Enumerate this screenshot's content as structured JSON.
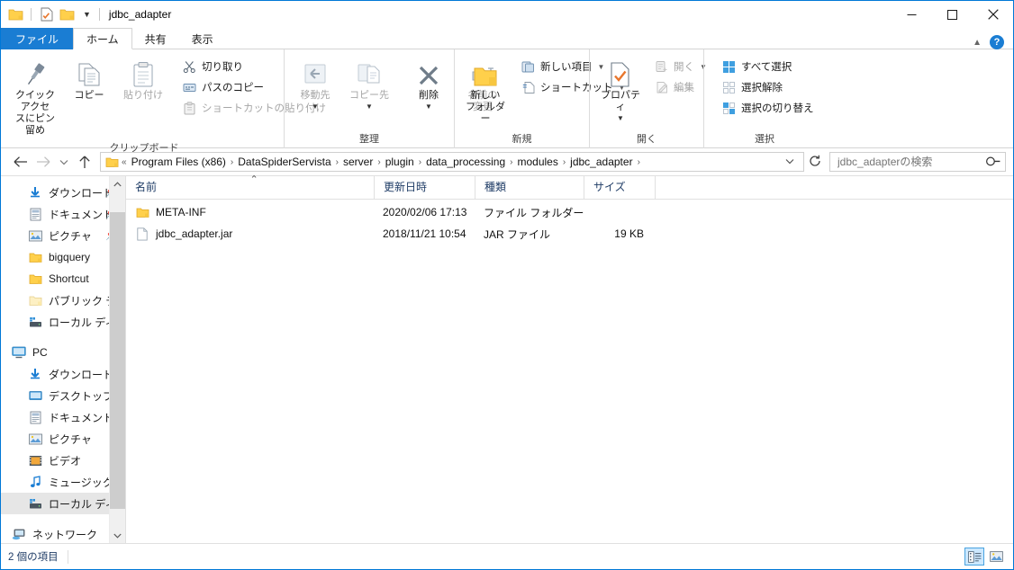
{
  "window": {
    "title": "jdbc_adapter",
    "quick_access": [
      {
        "name": "folder-icon",
        "label": "フォルダー"
      },
      {
        "name": "properties-icon",
        "label": "プロパティ"
      },
      {
        "name": "new-folder-icon",
        "label": "新しいフォルダー"
      }
    ],
    "controls": {
      "minimize": "—",
      "maximize": "☐",
      "close": "✕"
    }
  },
  "tabs": [
    {
      "label": "ファイル",
      "state": "file"
    },
    {
      "label": "ホーム",
      "state": "active"
    },
    {
      "label": "共有",
      "state": "normal"
    },
    {
      "label": "表示",
      "state": "normal"
    }
  ],
  "ribbon": {
    "help_label": "?",
    "groups": [
      {
        "label": "クリップボード",
        "big": [
          {
            "label": "クイック アクセ\nスにピン留め",
            "line1": "クイック アクセ",
            "line2": "スにピン留め",
            "icon": "pin-icon",
            "disabled": false
          },
          {
            "label": "コピー",
            "line1": "コピー",
            "line2": "",
            "icon": "copy-icon",
            "disabled": false
          },
          {
            "label": "貼り付け",
            "line1": "貼り付け",
            "line2": "",
            "icon": "paste-icon",
            "disabled": true
          }
        ],
        "small": [
          {
            "label": "切り取り",
            "icon": "scissors-icon",
            "disabled": false
          },
          {
            "label": "パスのコピー",
            "icon": "copy-path-icon",
            "disabled": false
          },
          {
            "label": "ショートカットの貼り付け",
            "icon": "paste-shortcut-icon",
            "disabled": true
          }
        ]
      },
      {
        "label": "整理",
        "big": [
          {
            "line1": "移動先",
            "line2": "",
            "icon": "move-to-icon",
            "disabled": true,
            "dropdown": true
          },
          {
            "line1": "コピー先",
            "line2": "",
            "icon": "copy-to-icon",
            "disabled": true,
            "dropdown": true
          },
          {
            "line1": "削除",
            "line2": "",
            "icon": "delete-icon",
            "disabled": false,
            "dropdown": true
          },
          {
            "line1": "名前の",
            "line2": "変更",
            "icon": "rename-icon",
            "disabled": true
          }
        ],
        "small": []
      },
      {
        "label": "新規",
        "big": [
          {
            "line1": "新しい",
            "line2": "フォルダー",
            "icon": "new-folder-icon",
            "disabled": false
          }
        ],
        "small": [
          {
            "label": "新しい項目",
            "icon": "new-item-icon",
            "disabled": false,
            "dropdown": true
          },
          {
            "label": "ショートカット",
            "icon": "shortcut-icon",
            "disabled": false,
            "dropdown": true
          }
        ]
      },
      {
        "label": "開く",
        "big": [
          {
            "line1": "プロパティ",
            "line2": "",
            "icon": "properties-icon",
            "disabled": false,
            "dropdown": true
          }
        ],
        "small": [
          {
            "label": "開く",
            "icon": "open-icon",
            "disabled": true,
            "dropdown": true
          },
          {
            "label": "編集",
            "icon": "edit-icon",
            "disabled": true
          }
        ]
      },
      {
        "label": "選択",
        "big": [],
        "small": [
          {
            "label": "すべて選択",
            "icon": "select-all-icon",
            "disabled": false
          },
          {
            "label": "選択解除",
            "icon": "select-none-icon",
            "disabled": false
          },
          {
            "label": "選択の切り替え",
            "icon": "invert-selection-icon",
            "disabled": false
          }
        ]
      }
    ]
  },
  "address": {
    "back": "←",
    "forward": "→",
    "history": "⌄",
    "up": "↑",
    "overflow": "«",
    "breadcrumbs": [
      "Program Files (x86)",
      "DataSpiderServista",
      "server",
      "plugin",
      "data_processing",
      "modules",
      "jdbc_adapter"
    ],
    "separator": "›",
    "dropdown": "⌄",
    "refresh": "↺"
  },
  "search": {
    "placeholder": "jdbc_adapterの検索",
    "value": ""
  },
  "nav": {
    "items": [
      {
        "label": "ダウンロード",
        "icon": "download-icon",
        "indent": 1,
        "pinned": true,
        "selected": false
      },
      {
        "label": "ドキュメント",
        "icon": "documents-icon",
        "indent": 1,
        "pinned": true,
        "selected": false
      },
      {
        "label": "ピクチャ",
        "icon": "pictures-icon",
        "indent": 1,
        "pinned": true,
        "selected": false
      },
      {
        "label": "bigquery",
        "icon": "folder-icon",
        "indent": 1,
        "pinned": false,
        "selected": false
      },
      {
        "label": "Shortcut",
        "icon": "folder-icon",
        "indent": 1,
        "pinned": false,
        "selected": false
      },
      {
        "label": "パブリック デスクトッ",
        "icon": "folder-pale-icon",
        "indent": 1,
        "pinned": false,
        "selected": false
      },
      {
        "label": "ローカル ディスク (C",
        "icon": "drive-icon",
        "indent": 1,
        "pinned": false,
        "selected": false
      },
      {
        "label": "",
        "icon": "",
        "indent": 0,
        "spacer": true
      },
      {
        "label": "PC",
        "icon": "pc-icon",
        "indent": 0,
        "pinned": false,
        "selected": false
      },
      {
        "label": "ダウンロード",
        "icon": "download-icon",
        "indent": 1,
        "pinned": false,
        "selected": false
      },
      {
        "label": "デスクトップ",
        "icon": "desktop-icon",
        "indent": 1,
        "pinned": false,
        "selected": false
      },
      {
        "label": "ドキュメント",
        "icon": "documents-icon",
        "indent": 1,
        "pinned": false,
        "selected": false
      },
      {
        "label": "ピクチャ",
        "icon": "pictures-icon",
        "indent": 1,
        "pinned": false,
        "selected": false
      },
      {
        "label": "ビデオ",
        "icon": "videos-icon",
        "indent": 1,
        "pinned": false,
        "selected": false
      },
      {
        "label": "ミュージック",
        "icon": "music-icon",
        "indent": 1,
        "pinned": false,
        "selected": false
      },
      {
        "label": "ローカル ディスク (C",
        "icon": "drive-icon",
        "indent": 1,
        "pinned": false,
        "selected": true
      },
      {
        "label": "",
        "icon": "",
        "indent": 0,
        "spacer": true
      },
      {
        "label": "ネットワーク",
        "icon": "network-icon",
        "indent": 0,
        "pinned": false,
        "selected": false
      }
    ]
  },
  "filelist": {
    "columns": [
      {
        "label": "名前",
        "sorted": true
      },
      {
        "label": "更新日時",
        "sorted": false
      },
      {
        "label": "種類",
        "sorted": false
      },
      {
        "label": "サイズ",
        "sorted": false
      }
    ],
    "rows": [
      {
        "name": "META-INF",
        "modified": "2020/02/06 17:13",
        "type": "ファイル フォルダー",
        "size": "",
        "icon": "folder-icon"
      },
      {
        "name": "jdbc_adapter.jar",
        "modified": "2018/11/21 10:54",
        "type": "JAR ファイル",
        "size": "19 KB",
        "icon": "file-icon"
      }
    ]
  },
  "status": {
    "item_count": "2 個の項目",
    "views": [
      {
        "name": "details-view-button",
        "selected": true
      },
      {
        "name": "large-icons-view-button",
        "selected": false
      }
    ]
  },
  "colors": {
    "accent": "#1a7dd3",
    "selection": "#cce8ff",
    "header_text": "#1f3c66",
    "folder": "#ffd04b"
  }
}
